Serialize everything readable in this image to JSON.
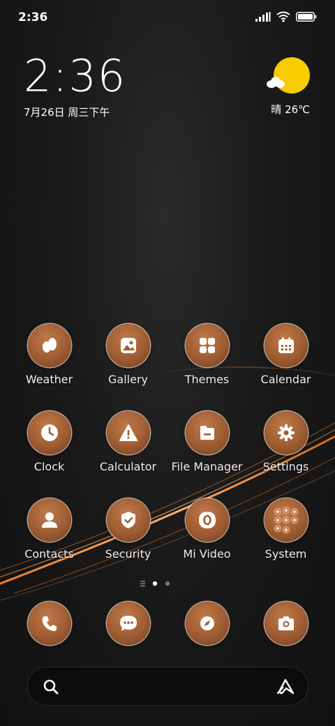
{
  "status_bar": {
    "time": "2:36"
  },
  "clock_widget": {
    "time": "2:36",
    "date": "7月26日 周三下午"
  },
  "weather_widget": {
    "text": "晴 26℃"
  },
  "apps": [
    {
      "label": "Weather",
      "icon": "weather-icon"
    },
    {
      "label": "Gallery",
      "icon": "gallery-icon"
    },
    {
      "label": "Themes",
      "icon": "themes-icon"
    },
    {
      "label": "Calendar",
      "icon": "calendar-icon"
    },
    {
      "label": "Clock",
      "icon": "clock-icon"
    },
    {
      "label": "Calculator",
      "icon": "calculator-icon"
    },
    {
      "label": "File Manager",
      "icon": "file-manager-icon"
    },
    {
      "label": "Settings",
      "icon": "settings-icon"
    },
    {
      "label": "Contacts",
      "icon": "contacts-icon"
    },
    {
      "label": "Security",
      "icon": "security-icon"
    },
    {
      "label": "Mi Video",
      "icon": "mi-video-icon"
    },
    {
      "label": "System",
      "icon": "system-folder-icon"
    }
  ],
  "dock": [
    {
      "icon": "phone-icon"
    },
    {
      "icon": "messages-icon"
    },
    {
      "icon": "browser-compass-icon"
    },
    {
      "icon": "camera-icon"
    }
  ],
  "page_indicator": {
    "pages": 2,
    "current": 1
  },
  "colors": {
    "icon_bronze": "#9e5c32",
    "sun_yellow": "#f7cc00",
    "streak_orange": "#ff8a2a"
  }
}
